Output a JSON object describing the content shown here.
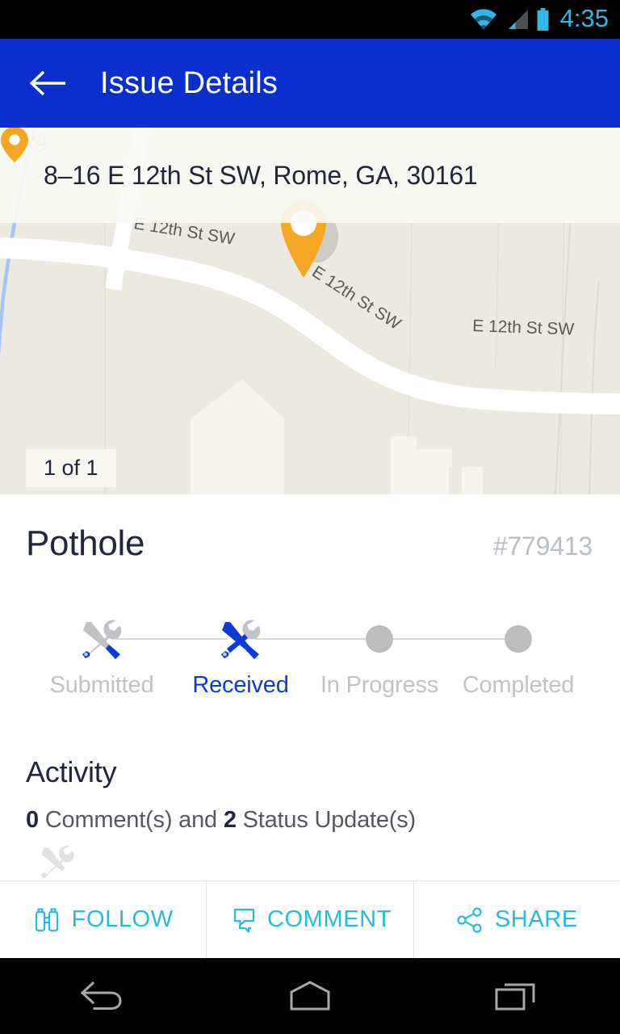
{
  "status_bar": {
    "time": "4:35",
    "icons": [
      "wifi-icon",
      "cellular-signal-icon",
      "battery-icon"
    ],
    "accent_color": "#33B5E5"
  },
  "app_bar": {
    "title": "Issue Details",
    "back_icon": "back-arrow-icon",
    "background_color": "#0A2FCC",
    "text_color": "#FFFFFF"
  },
  "map": {
    "address": "8–16  E 12th St SW, Rome, GA, 30161",
    "pin_icon": "map-pin-icon",
    "pin_color": "#F5A623",
    "photo_counter": "1 of 1",
    "street_labels": [
      "E 12th St SW",
      "E 12th St SW",
      "E 12th St SW"
    ],
    "corner_label": "Sh",
    "background_color": "#EBE9E0",
    "road_color": "#FFFFFF",
    "water_color": "#A8C4F0"
  },
  "issue": {
    "title": "Pothole",
    "id": "#779413"
  },
  "stepper": {
    "active_color": "#0A3BD4",
    "inactive_color": "#BFC2C7",
    "steps": [
      {
        "label": "Submitted",
        "state": "done",
        "icon": "tools-icon"
      },
      {
        "label": "Received",
        "state": "active",
        "icon": "tools-icon"
      },
      {
        "label": "In Progress",
        "state": "todo",
        "icon": "dot-icon"
      },
      {
        "label": "Completed",
        "state": "todo",
        "icon": "dot-icon"
      }
    ]
  },
  "activity": {
    "heading": "Activity",
    "comment_count": "0",
    "comment_text": " Comment(s) and ",
    "status_count": "2",
    "status_text": " Status Update(s)"
  },
  "actions": {
    "accent_color": "#23BCDE",
    "buttons": [
      {
        "label": "FOLLOW",
        "icon": "binoculars-icon"
      },
      {
        "label": "COMMENT",
        "icon": "chat-bubbles-icon"
      },
      {
        "label": "SHARE",
        "icon": "share-nodes-icon"
      }
    ]
  },
  "nav_bar": {
    "buttons": [
      {
        "name": "back",
        "icon": "nav-back-icon"
      },
      {
        "name": "home",
        "icon": "nav-home-icon"
      },
      {
        "name": "recents",
        "icon": "nav-recents-icon"
      }
    ]
  }
}
